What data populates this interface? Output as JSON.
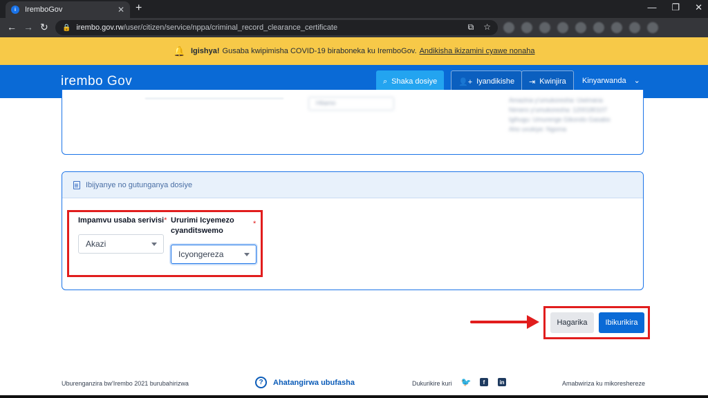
{
  "browser": {
    "tab_title": "IremboGov",
    "url_host": "irembo.gov.rw",
    "url_path": "/user/citizen/service/nppa/criminal_record_clearance_certificate"
  },
  "banner": {
    "bold": "Igishya!",
    "text": "Gusaba kwipimisha COVID-19 biraboneka ku IremboGov.",
    "link": "Andikisha ikizamini cyawe nonaha",
    "bg_color": "#f7c948"
  },
  "header": {
    "logo": "irembo",
    "logo_suffix": "Gov",
    "search_button": "Shaka dosiye",
    "register_button": "Iyandikishe",
    "login_button": "Kwinjira",
    "language": "Kinyarwanda",
    "brand_color": "#0a6ad6"
  },
  "prev_card": {
    "select_value": "Hitamo",
    "info_lines": [
      "Amazina y'umukoresha: Uwimana",
      "Nimero y'umukoresha: 1200180107",
      "Igihugu: Umurenge Gikondo Gasabo",
      "Aho uvukiye: Ngoma"
    ]
  },
  "section": {
    "title": "Ibijyanye no gutunganya dosiye",
    "fields": [
      {
        "label": "Impamvu usaba serivisi",
        "value": "Akazi"
      },
      {
        "label": "Ururimi Icyemezo cyanditswemo",
        "value": "Icyongereza"
      }
    ]
  },
  "actions": {
    "cancel": "Hagarika",
    "submit": "Ibikurikira"
  },
  "footer": {
    "copyright": "Uburenganzira bw'Irembo 2021 burubahirizwa",
    "help": "Ahatangirwa ubufasha",
    "follow": "Dukurikire kuri",
    "terms": "Amabwiriza ku mikoreshereze"
  }
}
